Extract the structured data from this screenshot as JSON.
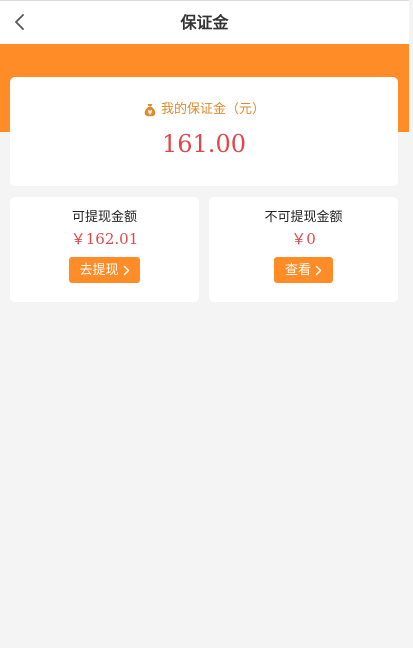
{
  "header": {
    "title": "保证金",
    "back_icon": "chevron-left-icon"
  },
  "deposit": {
    "icon": "money-bag-icon",
    "label": "我的保证金（元）",
    "amount": "161.00"
  },
  "withdrawable": {
    "label": "可提现金额",
    "amount": "￥162.01",
    "button_label": "去提现",
    "button_icon": "chevron-right-icon"
  },
  "non_withdrawable": {
    "label": "不可提现金额",
    "amount": "￥0",
    "button_label": "查看",
    "button_icon": "chevron-right-icon"
  },
  "colors": {
    "accent": "#ff8c26",
    "amount": "#e0474c",
    "label_orange": "#e08a2c",
    "background": "#f4f4f4"
  }
}
